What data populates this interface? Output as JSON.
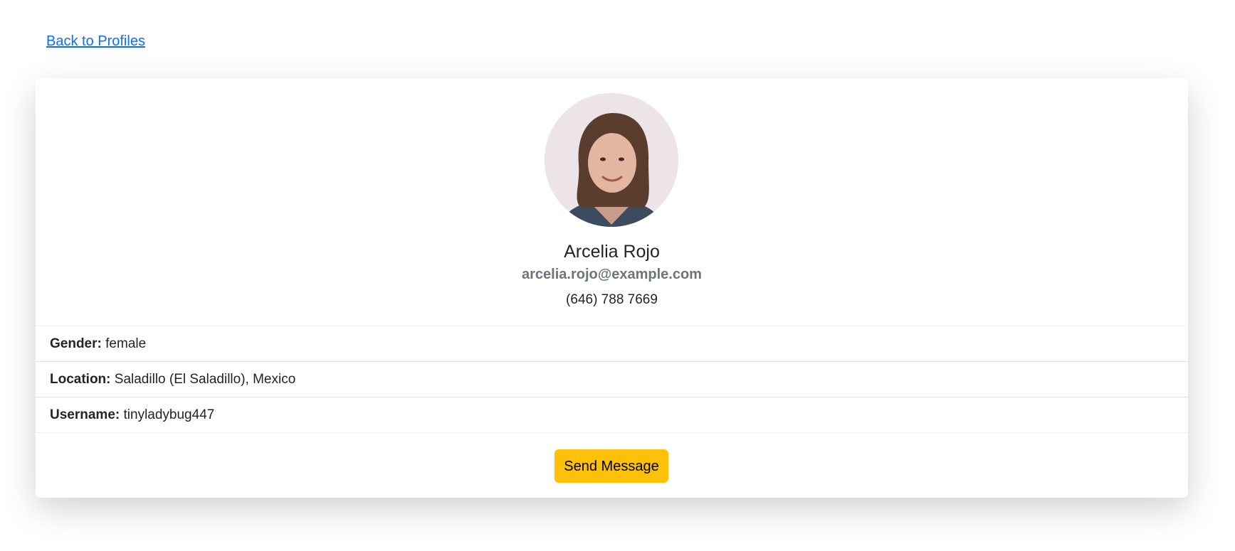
{
  "nav": {
    "back_label": "Back to Profiles"
  },
  "profile": {
    "avatar_icon": "profile-photo",
    "name": "Arcelia Rojo",
    "email": "arcelia.rojo@example.com",
    "phone": "(646) 788 7669",
    "details": [
      {
        "label": "Gender:",
        "value": "female"
      },
      {
        "label": "Location:",
        "value": "Saladillo (El Saladillo), Mexico"
      },
      {
        "label": "Username:",
        "value": "tinyladybug447"
      }
    ],
    "action_label": "Send Message"
  },
  "colors": {
    "link": "#0d6efd",
    "button": "#ffc107",
    "muted": "#6c757d"
  }
}
